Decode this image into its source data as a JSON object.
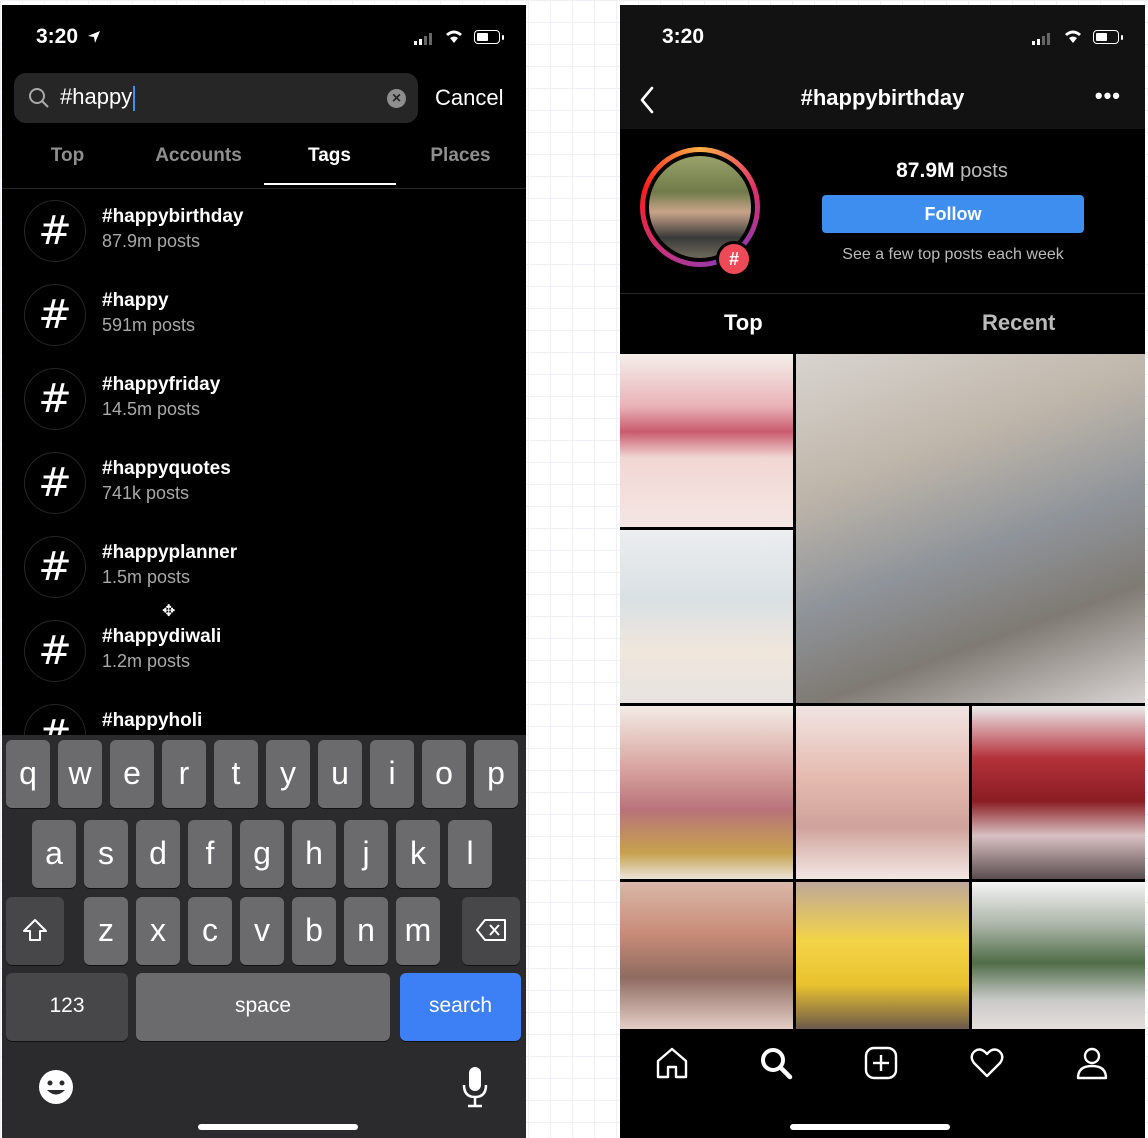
{
  "left_screen": {
    "status_time": "3:20",
    "search": {
      "query": "#happy",
      "cancel_label": "Cancel"
    },
    "tabs": [
      {
        "label": "Top",
        "active": false
      },
      {
        "label": "Accounts",
        "active": false
      },
      {
        "label": "Tags",
        "active": true
      },
      {
        "label": "Places",
        "active": false
      }
    ],
    "results": [
      {
        "tag": "#happybirthday",
        "count": "87.9m posts"
      },
      {
        "tag": "#happy",
        "count": "591m posts"
      },
      {
        "tag": "#happyfriday",
        "count": "14.5m posts"
      },
      {
        "tag": "#happyquotes",
        "count": "741k posts"
      },
      {
        "tag": "#happyplanner",
        "count": "1.5m posts"
      },
      {
        "tag": "#happydiwali",
        "count": "1.2m posts"
      },
      {
        "tag": "#happyholi",
        "count": ""
      }
    ],
    "hash_symbol": "#",
    "keyboard": {
      "row1": [
        "q",
        "w",
        "e",
        "r",
        "t",
        "y",
        "u",
        "i",
        "o",
        "p"
      ],
      "row2": [
        "a",
        "s",
        "d",
        "f",
        "g",
        "h",
        "j",
        "k",
        "l"
      ],
      "row3": [
        "z",
        "x",
        "c",
        "v",
        "b",
        "n",
        "m"
      ],
      "numbers_label": "123",
      "space_label": "space",
      "search_label": "search"
    }
  },
  "right_screen": {
    "status_time": "3:20",
    "title": "#happybirthday",
    "more_label": "•••",
    "post_count_value": "87.9M",
    "post_count_unit": "posts",
    "follow_label": "Follow",
    "subtext": "See a few top posts each week",
    "badge_symbol": "#",
    "tabs": [
      {
        "label": "Top",
        "active": true
      },
      {
        "label": "Recent",
        "active": false
      }
    ]
  },
  "colors": {
    "background": "#000000",
    "accent_blue": "#3e8ef0",
    "keyboard_bg": "#2b2b2d",
    "key": "#6b6b6d",
    "muted_text": "#a8a8a8"
  }
}
